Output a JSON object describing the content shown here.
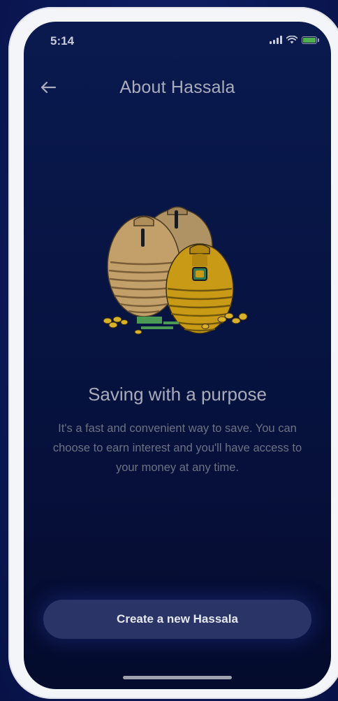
{
  "status_bar": {
    "time": "5:14"
  },
  "header": {
    "title": "About Hassala",
    "back_icon": "arrow-left-icon"
  },
  "content": {
    "headline": "Saving with a purpose",
    "description": "It's a fast and convenient way to save. You can choose to earn interest and you'll have access to your money at any time."
  },
  "actions": {
    "create_label": "Create a new Hassala"
  },
  "colors": {
    "screen_bg": "#071443",
    "button_bg": "#2a3466",
    "pot_tan": "#c8a56a",
    "pot_gold": "#c99a16"
  }
}
